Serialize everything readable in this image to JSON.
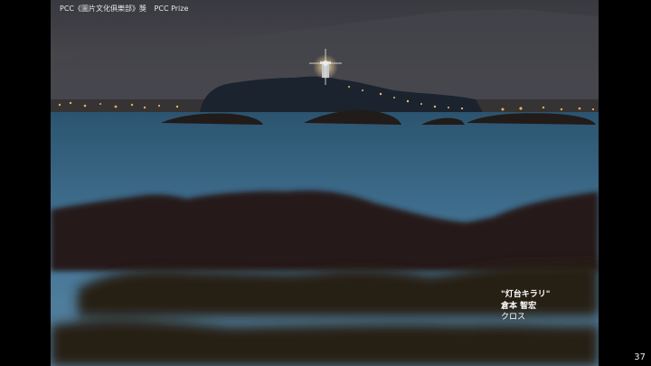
{
  "header": {
    "award_title": "PCC《圖片文化俱樂部》獎",
    "award_subtitle": "PCC Prize"
  },
  "credit": {
    "title": "\"灯台キラリ\"",
    "author": "倉本 智宏",
    "club": "クロス"
  },
  "page_number": "37",
  "colors": {
    "sky": "#4f4f5a",
    "sea": "#3a6a8c",
    "island": "#1c2430",
    "rocks": "#2a1e18",
    "lights": "#ffbf55"
  }
}
